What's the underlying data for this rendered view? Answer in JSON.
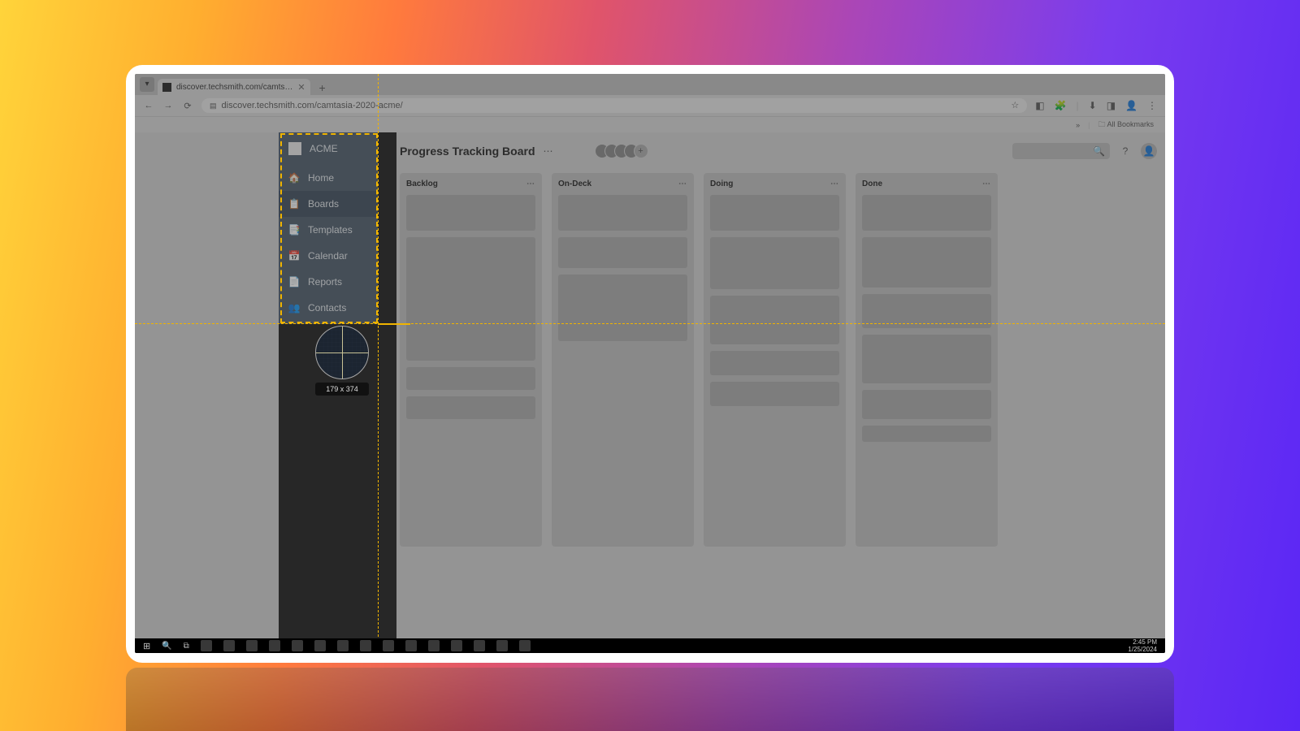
{
  "browser": {
    "tab_title": "discover.techsmith.com/camts…",
    "url": "discover.techsmith.com/camtasia-2020-acme/",
    "all_bookmarks": "All Bookmarks"
  },
  "sidebar": {
    "workspace": "ACME",
    "items": [
      {
        "label": "Home",
        "icon": "🏠"
      },
      {
        "label": "Boards",
        "icon": "📋"
      },
      {
        "label": "Templates",
        "icon": "📑"
      },
      {
        "label": "Calendar",
        "icon": "📅"
      },
      {
        "label": "Reports",
        "icon": "📄"
      },
      {
        "label": "Contacts",
        "icon": "👥"
      }
    ]
  },
  "board": {
    "title": "Progress Tracking Board",
    "columns": [
      {
        "title": "Backlog"
      },
      {
        "title": "On-Deck"
      },
      {
        "title": "Doing"
      },
      {
        "title": "Done"
      }
    ]
  },
  "snagit": {
    "dimensions": "179 x 374"
  },
  "taskbar": {
    "time": "2:45 PM",
    "date": "1/25/2024"
  }
}
